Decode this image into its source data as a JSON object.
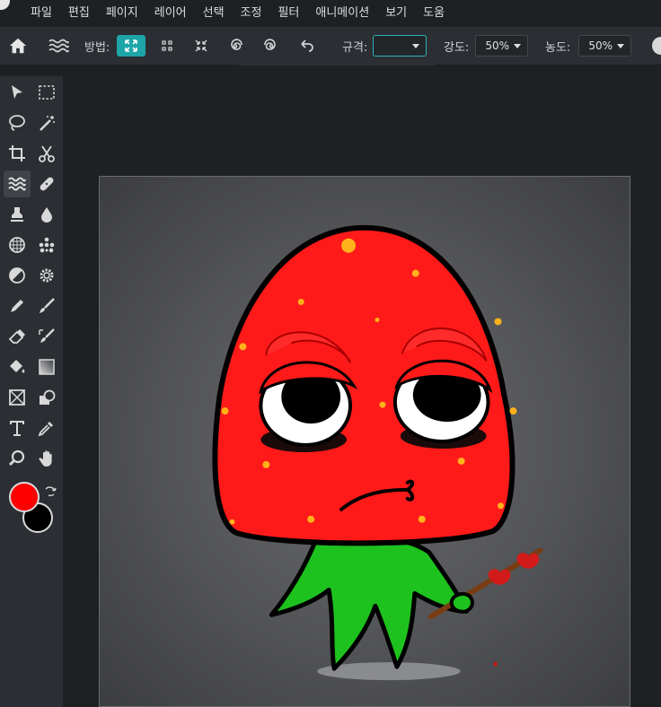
{
  "menu": {
    "items": [
      "파일",
      "편집",
      "페이지",
      "레이어",
      "선택",
      "조정",
      "필터",
      "애니메이션",
      "보기",
      "도움"
    ]
  },
  "options": {
    "method_label": "방법:",
    "scale_label": "규격:",
    "scale_value": "",
    "strength_label": "강도:",
    "strength_value": "50%",
    "density_label": "농도:",
    "density_value": "50%"
  },
  "colors": {
    "foreground": "#ff0000",
    "background": "#000000",
    "accent": "#1da5a7"
  },
  "tools": [
    "move-icon",
    "marquee-icon",
    "lasso-icon",
    "magic-wand-icon",
    "crop-icon",
    "scissors-icon",
    "liquify-icon",
    "healing-bandage-icon",
    "clone-stamp-icon",
    "blur-drop-icon",
    "sponge-icon",
    "dots-icon",
    "dodge-burn-icon",
    "gear-icon",
    "pencil-icon",
    "brush-icon",
    "eraser-icon",
    "color-replace-icon",
    "paint-bucket-icon",
    "gradient-icon",
    "shape-icon",
    "object-icon",
    "text-icon",
    "eyedropper-icon",
    "zoom-icon",
    "hand-icon"
  ]
}
